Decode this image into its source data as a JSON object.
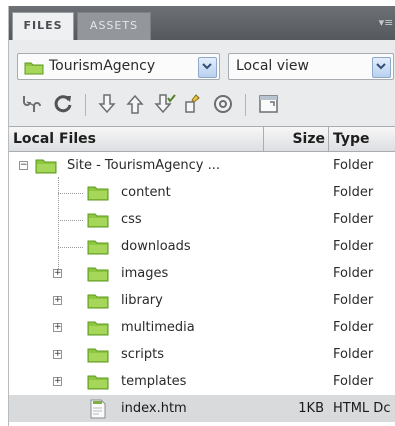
{
  "tabs": [
    {
      "label": "FILES",
      "active": true
    },
    {
      "label": "ASSETS",
      "active": false
    }
  ],
  "site_select": {
    "value": "TourismAgency"
  },
  "view_select": {
    "value": "Local view"
  },
  "toolbar": {
    "icons": [
      "connect-icon",
      "refresh-icon",
      "get-files-icon",
      "put-files-icon",
      "check-out-icon",
      "check-in-icon",
      "synchronize-icon",
      "expand-panel-icon"
    ]
  },
  "columns": {
    "local": "Local Files",
    "size": "Size",
    "type": "Type"
  },
  "rows": [
    {
      "name": "Site - TourismAgency ...",
      "size": "",
      "type": "Folder",
      "expander": "−"
    },
    {
      "name": "content",
      "size": "",
      "type": "Folder",
      "expander": ""
    },
    {
      "name": "css",
      "size": "",
      "type": "Folder",
      "expander": ""
    },
    {
      "name": "downloads",
      "size": "",
      "type": "Folder",
      "expander": ""
    },
    {
      "name": "images",
      "size": "",
      "type": "Folder",
      "expander": "+"
    },
    {
      "name": "library",
      "size": "",
      "type": "Folder",
      "expander": "+"
    },
    {
      "name": "multimedia",
      "size": "",
      "type": "Folder",
      "expander": "+"
    },
    {
      "name": "scripts",
      "size": "",
      "type": "Folder",
      "expander": "+"
    },
    {
      "name": "templates",
      "size": "",
      "type": "Folder",
      "expander": "+"
    },
    {
      "name": "index.htm",
      "size": "1KB",
      "type": "HTML Dc",
      "expander": "",
      "selected": true
    }
  ],
  "colors": {
    "folder": "#8dc63f",
    "folder_dark": "#5e9a1f",
    "panel_bg": "#e9ebec",
    "tab_bar": "#5e6165"
  }
}
